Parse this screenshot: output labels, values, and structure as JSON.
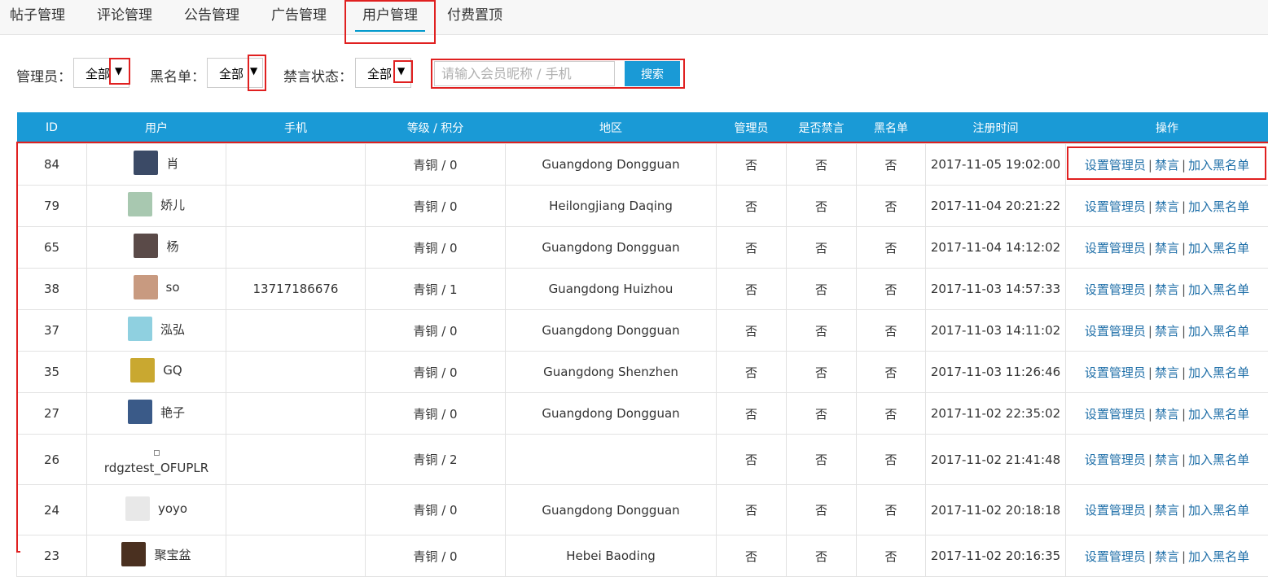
{
  "tabs": [
    "帖子管理",
    "评论管理",
    "公告管理",
    "广告管理",
    "用户管理",
    "付费置顶"
  ],
  "active_tab": "用户管理",
  "filters": {
    "admin": {
      "label": "管理员：",
      "value": "全部"
    },
    "blacklist": {
      "label": "黑名单：",
      "value": "全部"
    },
    "mute": {
      "label": "禁言状态：",
      "value": "全部"
    },
    "arrow_icon": "dropdown-arrow-icon"
  },
  "search": {
    "placeholder": "请输入会员昵称 / 手机",
    "button": "搜索"
  },
  "table": {
    "headers": [
      "ID",
      "用户",
      "手机",
      "等级 / 积分",
      "地区",
      "管理员",
      "是否禁言",
      "黑名单",
      "注册时间",
      "操作"
    ],
    "actions": {
      "set_admin": "设置管理员",
      "mute": "禁言",
      "blacklist": "加入黑名单",
      "separator": "|"
    },
    "rows": [
      {
        "id": "84",
        "name": "肖",
        "phone": "",
        "level": "青铜 / 0",
        "region": "Guangdong Dongguan",
        "admin": "否",
        "muted": "否",
        "black": "否",
        "time": "2017-11-05 19:02:00",
        "avatar_color": "#3b4a66"
      },
      {
        "id": "79",
        "name": "娇儿",
        "phone": "",
        "level": "青铜 / 0",
        "region": "Heilongjiang Daqing",
        "admin": "否",
        "muted": "否",
        "black": "否",
        "time": "2017-11-04 20:21:22",
        "avatar_color": "#a8c8b0"
      },
      {
        "id": "65",
        "name": "杨",
        "phone": "",
        "level": "青铜 / 0",
        "region": "Guangdong Dongguan",
        "admin": "否",
        "muted": "否",
        "black": "否",
        "time": "2017-11-04 14:12:02",
        "avatar_color": "#5a4a48"
      },
      {
        "id": "38",
        "name": "so",
        "phone": "13717186676",
        "level": "青铜 / 1",
        "region": "Guangdong Huizhou",
        "admin": "否",
        "muted": "否",
        "black": "否",
        "time": "2017-11-03 14:57:33",
        "avatar_color": "#c89a80"
      },
      {
        "id": "37",
        "name": "泓弘",
        "phone": "",
        "level": "青铜 / 0",
        "region": "Guangdong Dongguan",
        "admin": "否",
        "muted": "否",
        "black": "否",
        "time": "2017-11-03 14:11:02",
        "avatar_color": "#8fd0e0"
      },
      {
        "id": "35",
        "name": "GQ",
        "phone": "",
        "level": "青铜 / 0",
        "region": "Guangdong Shenzhen",
        "admin": "否",
        "muted": "否",
        "black": "否",
        "time": "2017-11-03 11:26:46",
        "avatar_color": "#c9a830"
      },
      {
        "id": "27",
        "name": "艳子",
        "phone": "",
        "level": "青铜 / 0",
        "region": "Guangdong Dongguan",
        "admin": "否",
        "muted": "否",
        "black": "否",
        "time": "2017-11-02 22:35:02",
        "avatar_color": "#3a5a88"
      },
      {
        "id": "26",
        "name": "rdgztest_OFUPLR",
        "phone": "",
        "level": "青铜 / 2",
        "region": "",
        "admin": "否",
        "muted": "否",
        "black": "否",
        "time": "2017-11-02 21:41:48",
        "avatar_color": "#ffffff"
      },
      {
        "id": "24",
        "name": "yoyo",
        "phone": "",
        "level": "青铜 / 0",
        "region": "Guangdong Dongguan",
        "admin": "否",
        "muted": "否",
        "black": "否",
        "time": "2017-11-02 20:18:18",
        "avatar_color": "#e8e8e8"
      },
      {
        "id": "23",
        "name": "聚宝盆",
        "phone": "",
        "level": "青铜 / 0",
        "region": "Hebei Baoding",
        "admin": "否",
        "muted": "否",
        "black": "否",
        "time": "2017-11-02 20:16:35",
        "avatar_color": "#4a3020"
      }
    ]
  }
}
